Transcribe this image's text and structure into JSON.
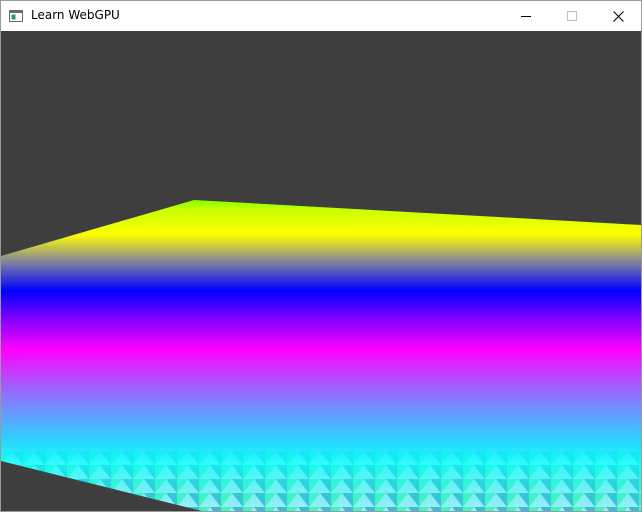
{
  "window": {
    "title": "Learn WebGPU",
    "icon": "app-window-icon",
    "controls": [
      {
        "name": "minimize-icon"
      },
      {
        "name": "maximize-icon"
      },
      {
        "name": "close-icon"
      }
    ]
  },
  "scene": {
    "clear_color": "#3e3e3e",
    "plane_gradient": [
      "#7fff00",
      "#ffff00",
      "#0000ff",
      "#ff00ff",
      "#00ffff"
    ]
  }
}
